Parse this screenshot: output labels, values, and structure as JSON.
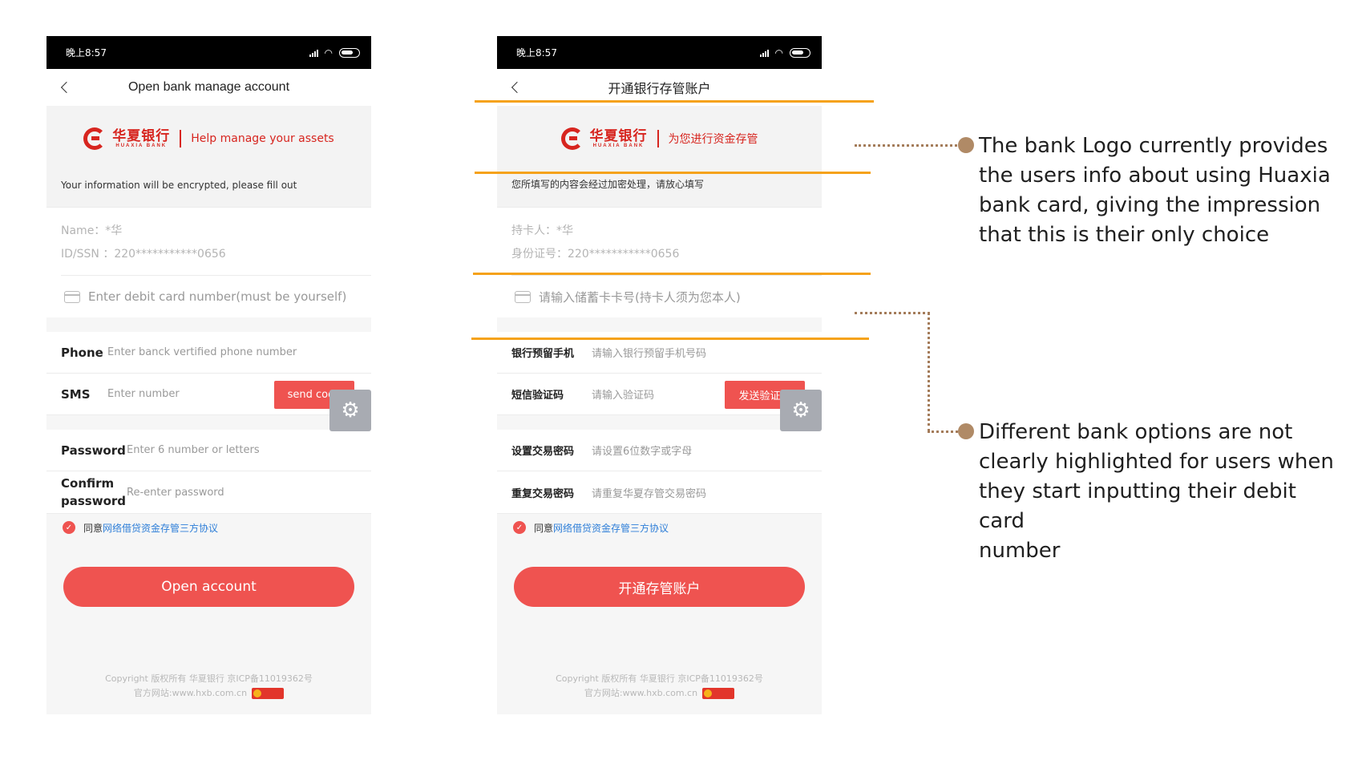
{
  "colors": {
    "accent": "#ef5350",
    "bank_red": "#d7251f",
    "highlight": "#f5a21b",
    "connector": "#a47c5a",
    "link": "#2f7fd8"
  },
  "phones": [
    {
      "status_time": "晚上8:57",
      "title": "Open bank manage account",
      "bank_name": "华夏银行",
      "bank_name_en": "HUAXIA BANK",
      "slogan": "Help manage your assets",
      "notice": "Your information will be encrypted, please fill out",
      "name_line": "Name：*华",
      "id_line": "ID/SSN  ：220***********0656",
      "card_placeholder": "Enter debit card number(must be yourself)",
      "phone_label": "Phone",
      "phone_placeholder": "Enter banck vertified phone number",
      "sms_label": "SMS",
      "sms_placeholder": "Enter number",
      "send_code": "send code",
      "password_label": "Password",
      "password_placeholder": "Enter 6 number or letters",
      "confirm_label_1": "Confirm",
      "confirm_label_2": "password",
      "confirm_placeholder": "Re-enter password",
      "agree_prefix": "同意",
      "agree_link": "网络借贷资金存管三方协议",
      "cta": "Open account",
      "copyright": "Copyright 版权所有 华夏银行 京ICP备11019362号",
      "website": "官方网站:www.hxb.com.cn"
    },
    {
      "status_time": "晚上8:57",
      "title": "开通银行存管账户",
      "bank_name": "华夏银行",
      "bank_name_en": "HUAXIA BANK",
      "slogan": "为您进行资金存管",
      "notice": "您所填写的内容会经过加密处理，请放心填写",
      "name_line": "持卡人：*华",
      "id_line": "身份证号：220***********0656",
      "card_placeholder": "请输入储蓄卡卡号(持卡人须为您本人)",
      "phone_label": "银行预留手机",
      "phone_placeholder": "请输入银行预留手机号码",
      "sms_label": "短信验证码",
      "sms_placeholder": "请输入验证码",
      "send_code": "发送验证码",
      "password_label": "设置交易密码",
      "password_placeholder": "请设置6位数字或字母",
      "confirm_label_1": "重复交易密码",
      "confirm_label_2": "",
      "confirm_placeholder": "请重复华夏存管交易密码",
      "agree_prefix": "同意",
      "agree_link": "网络借贷资金存管三方协议",
      "cta": "开通存管账户",
      "copyright": "Copyright 版权所有 华夏银行 京ICP备11019362号",
      "website": "官方网站:www.hxb.com.cn"
    }
  ],
  "annotations": {
    "logo_note": [
      "The bank Logo currently provides",
      "the users info about using Huaxia",
      "bank card, giving the impression",
      "that this is their only choice"
    ],
    "options_note": [
      "Different  bank options are not",
      "clearly highlighted for users when",
      "they start inputting their debit card",
      "number"
    ]
  }
}
